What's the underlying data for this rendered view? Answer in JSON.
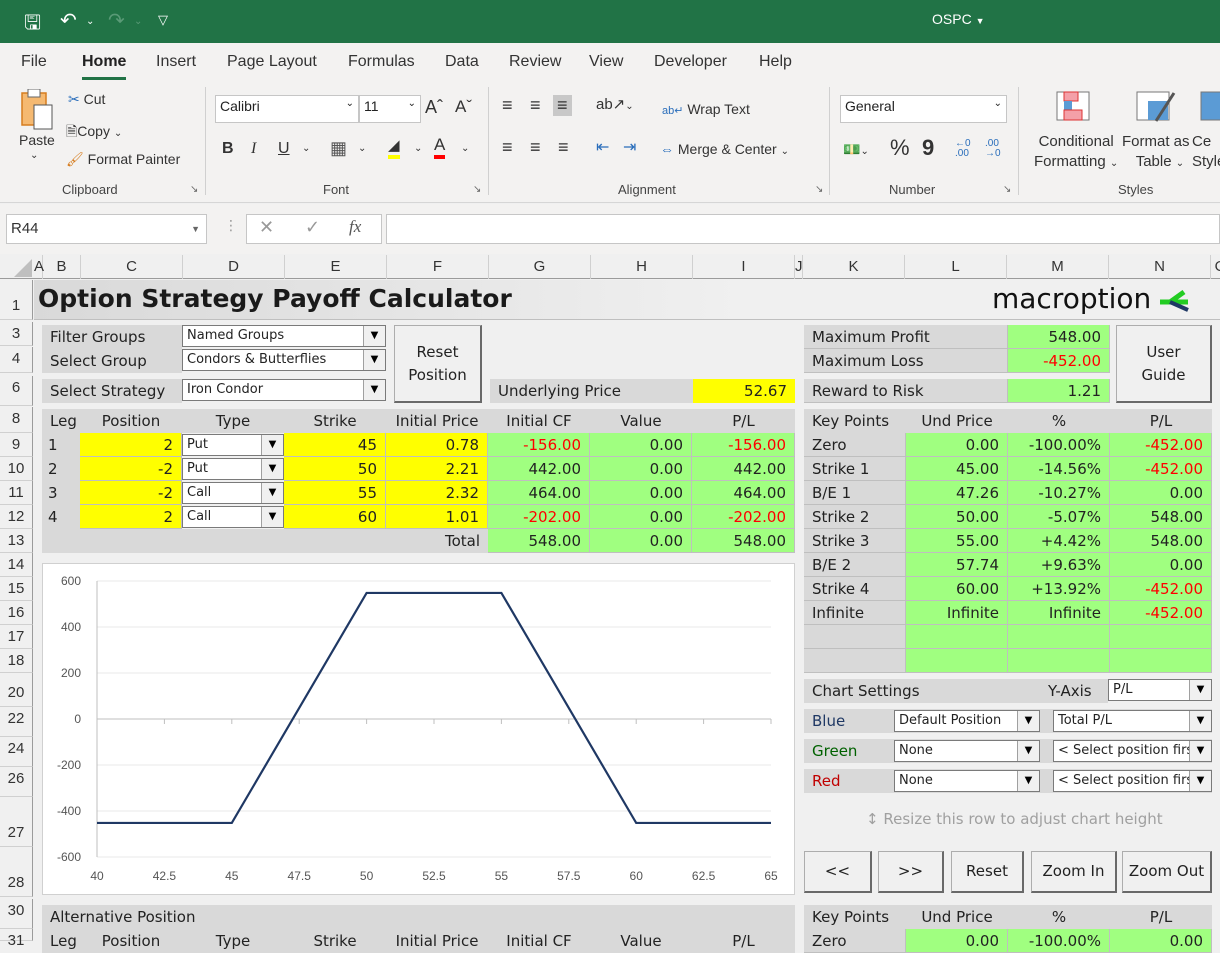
{
  "app": {
    "doc_title": "OSPC"
  },
  "menu": {
    "tabs": [
      "File",
      "Home",
      "Insert",
      "Page Layout",
      "Formulas",
      "Data",
      "Review",
      "View",
      "Developer",
      "Help"
    ],
    "active": "Home"
  },
  "ribbon": {
    "clipboard": {
      "paste": "Paste",
      "cut": "Cut",
      "copy": "Copy",
      "format_painter": "Format Painter",
      "label": "Clipboard"
    },
    "font": {
      "name": "Calibri",
      "size": "11",
      "bold": "B",
      "italic": "I",
      "underline": "U",
      "label": "Font"
    },
    "alignment": {
      "wrap_text": "Wrap Text",
      "merge_center": "Merge & Center",
      "label": "Alignment"
    },
    "number": {
      "format": "General",
      "percent": "%",
      "comma": "9",
      "label": "Number"
    },
    "styles": {
      "conditional": "Conditional",
      "conditional2": "Formatting",
      "format_as": "Format as",
      "format_as2": "Table",
      "cell": "Ce",
      "cell2": "Style",
      "label": "Styles"
    }
  },
  "formula_bar": {
    "name_box": "R44",
    "fx": "fx",
    "value": ""
  },
  "columns": [
    "A",
    "B",
    "C",
    "D",
    "E",
    "F",
    "G",
    "H",
    "I",
    "J",
    "K",
    "L",
    "M",
    "N",
    "O"
  ],
  "rows": [
    "1",
    "3",
    "4",
    "6",
    "8",
    "9",
    "10",
    "11",
    "12",
    "13",
    "14",
    "15",
    "16",
    "17",
    "18",
    "20",
    "22",
    "24",
    "26",
    "27",
    "28",
    "30",
    "31"
  ],
  "sheet": {
    "title": "Option Strategy Payoff Calculator",
    "logo": "macroption",
    "filter_groups": {
      "label": "Filter Groups",
      "value": "Named Groups"
    },
    "select_group": {
      "label": "Select Group",
      "value": "Condors & Butterflies"
    },
    "select_strategy": {
      "label": "Select Strategy",
      "value": "Iron Condor"
    },
    "reset_position": "Reset Position",
    "underlying_price": {
      "label": "Underlying Price",
      "value": "52.67"
    },
    "max_profit": {
      "label": "Maximum Profit",
      "value": "548.00"
    },
    "max_loss": {
      "label": "Maximum Loss",
      "value": "-452.00"
    },
    "reward_risk": {
      "label": "Reward to Risk",
      "value": "1.21"
    },
    "user_guide": "User Guide",
    "legs_header": [
      "Leg",
      "Position",
      "Type",
      "Strike",
      "Initial Price",
      "Initial CF",
      "Value",
      "P/L"
    ],
    "legs": [
      {
        "leg": "1",
        "position": "2",
        "type": "Put",
        "strike": "45",
        "price": "0.78",
        "cf": "-156.00",
        "value": "0.00",
        "pl": "-156.00"
      },
      {
        "leg": "2",
        "position": "-2",
        "type": "Put",
        "strike": "50",
        "price": "2.21",
        "cf": "442.00",
        "value": "0.00",
        "pl": "442.00"
      },
      {
        "leg": "3",
        "position": "-2",
        "type": "Call",
        "strike": "55",
        "price": "2.32",
        "cf": "464.00",
        "value": "0.00",
        "pl": "464.00"
      },
      {
        "leg": "4",
        "position": "2",
        "type": "Call",
        "strike": "60",
        "price": "1.01",
        "cf": "-202.00",
        "value": "0.00",
        "pl": "-202.00"
      }
    ],
    "total": {
      "label": "Total",
      "cf": "548.00",
      "value": "0.00",
      "pl": "548.00"
    },
    "key_points_header": [
      "Key Points",
      "Und Price",
      "%",
      "P/L"
    ],
    "key_points": [
      {
        "name": "Zero",
        "und": "0.00",
        "pct": "-100.00%",
        "pl": "-452.00"
      },
      {
        "name": "Strike 1",
        "und": "45.00",
        "pct": "-14.56%",
        "pl": "-452.00"
      },
      {
        "name": "B/E 1",
        "und": "47.26",
        "pct": "-10.27%",
        "pl": "0.00"
      },
      {
        "name": "Strike 2",
        "und": "50.00",
        "pct": "-5.07%",
        "pl": "548.00"
      },
      {
        "name": "Strike 3",
        "und": "55.00",
        "pct": "+4.42%",
        "pl": "548.00"
      },
      {
        "name": "B/E 2",
        "und": "57.74",
        "pct": "+9.63%",
        "pl": "0.00"
      },
      {
        "name": "Strike 4",
        "und": "60.00",
        "pct": "+13.92%",
        "pl": "-452.00"
      },
      {
        "name": "Infinite",
        "und": "Infinite",
        "pct": "Infinite",
        "pl": "-452.00"
      },
      {
        "name": "",
        "und": "",
        "pct": "",
        "pl": ""
      },
      {
        "name": "",
        "und": "",
        "pct": "",
        "pl": ""
      }
    ],
    "chart_settings": {
      "label": "Chart Settings",
      "yaxis_label": "Y-Axis",
      "yaxis_value": "P/L",
      "series": [
        {
          "color_name": "Blue",
          "position": "Default Position",
          "metric": "Total P/L",
          "color": "#1f3864"
        },
        {
          "color_name": "Green",
          "position": "None",
          "metric": "< Select position first",
          "color": "#006100"
        },
        {
          "color_name": "Red",
          "position": "None",
          "metric": "< Select position first",
          "color": "#c00000"
        }
      ]
    },
    "resize_hint": "Resize this row to adjust chart height",
    "nav_buttons": [
      "<<",
      ">>",
      "Reset",
      "Zoom In",
      "Zoom Out"
    ],
    "alternative": {
      "label": "Alternative Position",
      "header": [
        "Leg",
        "Position",
        "Type",
        "Strike",
        "Initial Price",
        "Initial CF",
        "Value",
        "P/L"
      ]
    },
    "key_points2_header": [
      "Key Points",
      "Und Price",
      "%",
      "P/L"
    ],
    "key_points2_first": {
      "name": "Zero",
      "und": "0.00",
      "pct": "-100.00%",
      "pl": "0.00"
    }
  },
  "chart_data": {
    "type": "line",
    "title": "",
    "xlabel": "",
    "ylabel": "",
    "x_ticks": [
      "40",
      "42.5",
      "45",
      "47.5",
      "50",
      "52.5",
      "55",
      "57.5",
      "60",
      "62.5",
      "65"
    ],
    "y_ticks": [
      "600",
      "400",
      "200",
      "0",
      "-200",
      "-400",
      "-600"
    ],
    "xlim": [
      40,
      65
    ],
    "ylim": [
      -600,
      600
    ],
    "grid": true,
    "series": [
      {
        "name": "Total P/L",
        "color": "#1f3864",
        "x": [
          40,
          45,
          50,
          55,
          60,
          65
        ],
        "y": [
          -452,
          -452,
          548,
          548,
          -452,
          -452
        ]
      }
    ]
  }
}
